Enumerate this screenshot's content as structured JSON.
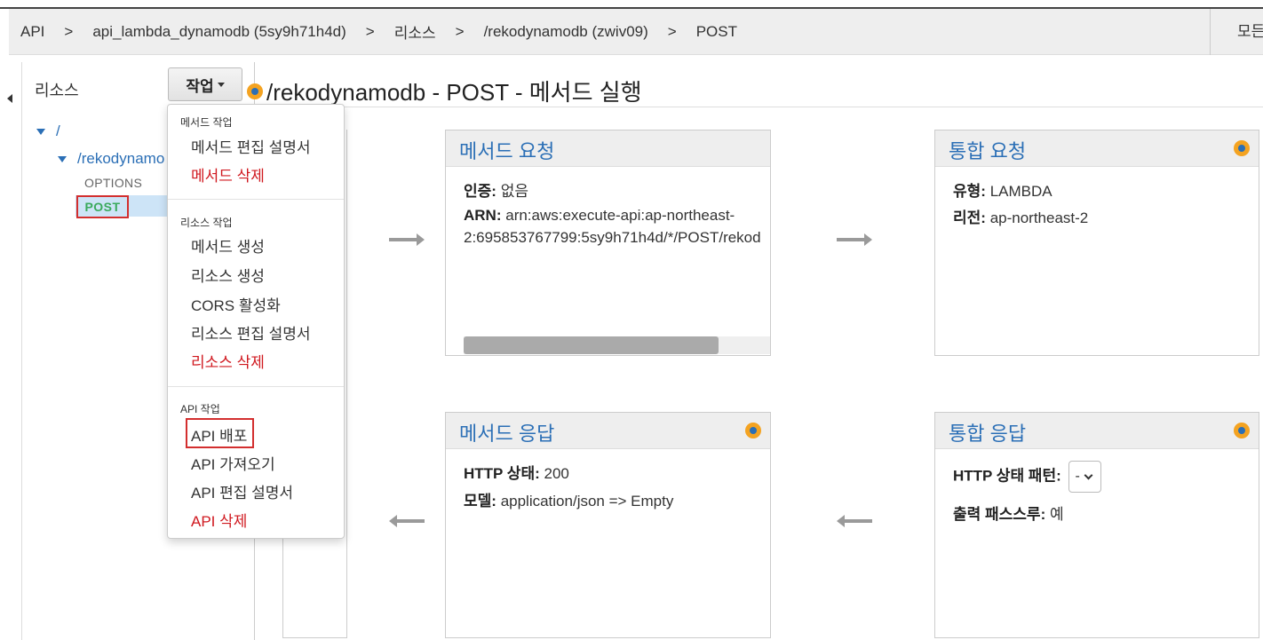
{
  "breadcrumb": {
    "items": [
      "API",
      "api_lambda_dynamodb (5sy9h71h4d)",
      "리소스",
      "/rekodynamodb (zwiv09)",
      "POST"
    ],
    "separator": ">",
    "right_label": "모든"
  },
  "sidebar": {
    "title": "리소스",
    "action_button": "작업",
    "tree": {
      "root": "/",
      "child": "/rekodynamo",
      "methods": [
        "OPTIONS",
        "POST"
      ]
    }
  },
  "dropdown": {
    "sections": [
      {
        "header": "메서드 작업",
        "items": [
          {
            "label": "메서드 편집 설명서",
            "danger": false
          },
          {
            "label": "메서드 삭제",
            "danger": true
          }
        ]
      },
      {
        "header": "리소스 작업",
        "items": [
          {
            "label": "메서드 생성",
            "danger": false
          },
          {
            "label": "리소스 생성",
            "danger": false
          },
          {
            "label": "CORS 활성화",
            "danger": false
          },
          {
            "label": "리소스 편집 설명서",
            "danger": false
          },
          {
            "label": "리소스 삭제",
            "danger": true
          }
        ]
      },
      {
        "header": "API 작업",
        "items": [
          {
            "label": "API 배포",
            "danger": false
          },
          {
            "label": "API 가져오기",
            "danger": false
          },
          {
            "label": "API 편집 설명서",
            "danger": false
          },
          {
            "label": "API 삭제",
            "danger": true
          }
        ]
      }
    ]
  },
  "main": {
    "title": "/rekodynamodb - POST - 메서드 실행",
    "method_request": {
      "title": "메서드 요청",
      "auth_label": "인증:",
      "auth_value": "없음",
      "arn_label": "ARN:",
      "arn_line1": "arn:aws:execute-api:ap-northeast-",
      "arn_line2": "2:695853767799:5sy9h71h4d/*/POST/rekod"
    },
    "integration_request": {
      "title": "통합 요청",
      "type_label": "유형:",
      "type_value": "LAMBDA",
      "region_label": "리전:",
      "region_value": "ap-northeast-2"
    },
    "method_response": {
      "title": "메서드 응답",
      "status_label": "HTTP 상태:",
      "status_value": "200",
      "model_label": "모델:",
      "model_value": "application/json => Empty"
    },
    "integration_response": {
      "title": "통합 응답",
      "pattern_label": "HTTP 상태 패턴:",
      "pattern_value": "-",
      "passthrough_label": "출력 패스스루:",
      "passthrough_value": "예"
    }
  },
  "colors": {
    "link": "#2b6fb6",
    "danger": "#d0181f",
    "highlight_border": "#d32f2f",
    "method_post": "#3aaa5c",
    "icon_outer": "#f4a321",
    "icon_inner": "#2b6fb6"
  }
}
